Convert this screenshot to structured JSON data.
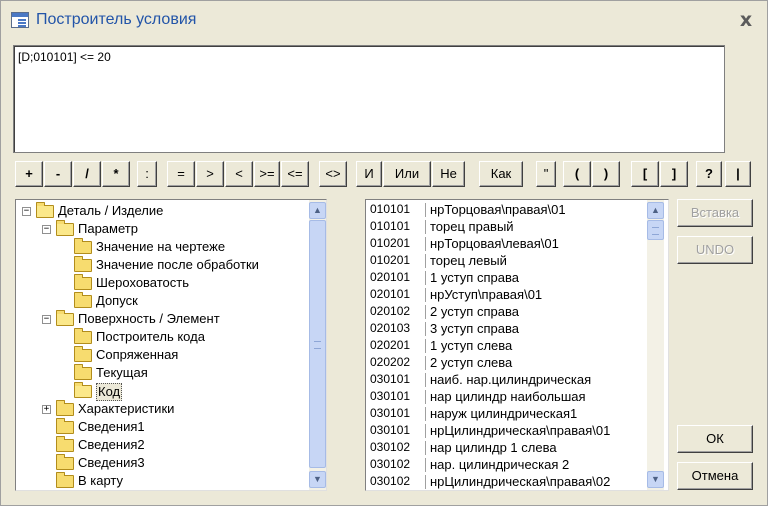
{
  "window": {
    "title": "Построитель условия",
    "close_glyph": "x"
  },
  "expression": {
    "value": "[D;010101] <= 20"
  },
  "operators": [
    "+",
    "-",
    "/",
    "*",
    ":",
    "=",
    ">",
    "<",
    ">=",
    "<=",
    "<>",
    "И",
    "Или",
    "Не",
    "Как",
    "\"",
    "(",
    ")",
    "[",
    "]",
    "?",
    "|"
  ],
  "tree": {
    "items": [
      {
        "label": "Деталь / Изделие",
        "level": 0,
        "expander": "-",
        "open": true
      },
      {
        "label": "Параметр",
        "level": 1,
        "expander": "-",
        "open": true
      },
      {
        "label": "Значение на чертеже",
        "level": 2,
        "expander": "",
        "open": false
      },
      {
        "label": "Значение после обработки",
        "level": 2,
        "expander": "",
        "open": false
      },
      {
        "label": "Шероховатость",
        "level": 2,
        "expander": "",
        "open": false
      },
      {
        "label": "Допуск",
        "level": 2,
        "expander": "",
        "open": false
      },
      {
        "label": "Поверхность / Элемент",
        "level": 1,
        "expander": "-",
        "open": true
      },
      {
        "label": "Построитель кода",
        "level": 2,
        "expander": "",
        "open": false
      },
      {
        "label": "Сопряженная",
        "level": 2,
        "expander": "",
        "open": false
      },
      {
        "label": "Текущая",
        "level": 2,
        "expander": "",
        "open": false
      },
      {
        "label": "Код",
        "level": 2,
        "expander": "",
        "open": true,
        "selected": true
      },
      {
        "label": "Характеристики",
        "level": 1,
        "expander": "+",
        "open": false
      },
      {
        "label": "Сведения1",
        "level": 1,
        "expander": "",
        "open": false
      },
      {
        "label": "Сведения2",
        "level": 1,
        "expander": "",
        "open": false
      },
      {
        "label": "Сведения3",
        "level": 1,
        "expander": "",
        "open": false
      },
      {
        "label": "В карту",
        "level": 1,
        "expander": "",
        "open": false
      }
    ]
  },
  "list": {
    "rows": [
      {
        "code": "010101",
        "name": "нрТорцовая\\правая\\01"
      },
      {
        "code": "010101",
        "name": "торец правый"
      },
      {
        "code": "010201",
        "name": "нрТорцовая\\левая\\01"
      },
      {
        "code": "010201",
        "name": "торец левый"
      },
      {
        "code": "020101",
        "name": "1 уступ справа"
      },
      {
        "code": "020101",
        "name": "нрУступ\\правая\\01"
      },
      {
        "code": "020102",
        "name": "2 уступ справа"
      },
      {
        "code": "020103",
        "name": "3 уступ справа"
      },
      {
        "code": "020201",
        "name": "1 уступ слева"
      },
      {
        "code": "020202",
        "name": "2 уступ слева"
      },
      {
        "code": "030101",
        "name": "наиб. нар.цилиндрическая"
      },
      {
        "code": "030101",
        "name": "нар цилиндр наибольшая"
      },
      {
        "code": "030101",
        "name": "наруж цилиндрическая1"
      },
      {
        "code": "030101",
        "name": "нрЦилиндрическая\\правая\\01"
      },
      {
        "code": "030102",
        "name": "нар цилиндр 1 слева"
      },
      {
        "code": "030102",
        "name": "нар. цилиндрическая 2"
      },
      {
        "code": "030102",
        "name": "нрЦилиндрическая\\правая\\02"
      }
    ]
  },
  "side_buttons": {
    "insert": "Вставка",
    "undo": "UNDO",
    "ok": "ОК",
    "cancel": "Отмена"
  },
  "icons": {
    "window": "form-builder-icon",
    "close": "close-icon",
    "folder": "folder-icon",
    "scroll_up": "scroll-up-arrow-icon",
    "scroll_down": "scroll-down-arrow-icon"
  },
  "colors": {
    "window_bg": "#ece9d8",
    "title_text": "#2254a8",
    "folder": "#f7dc6f",
    "scroll": "#c7d6f5"
  }
}
